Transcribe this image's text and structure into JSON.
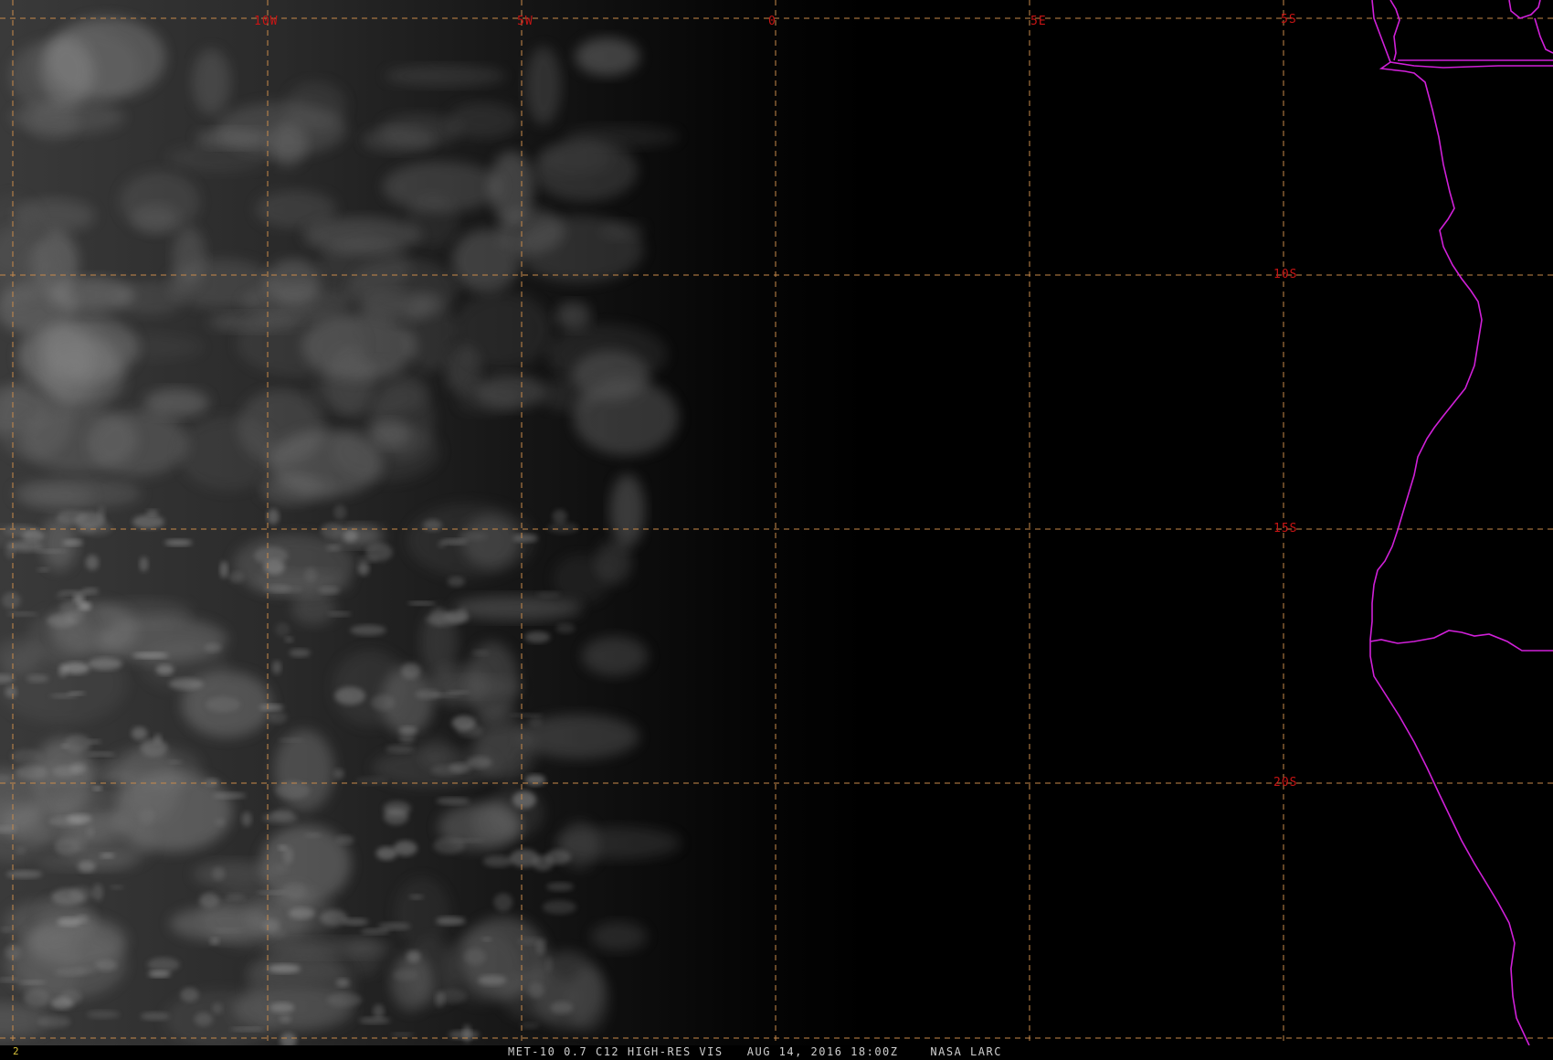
{
  "image": {
    "caption": "MET-10 0.7 C12 HIGH-RES VIS   AUG 14, 2016 18:00Z    NASA LARC",
    "frame_number": "2"
  },
  "grid": {
    "longitude_labels": [
      "10W",
      "5W",
      "0",
      "5E"
    ],
    "latitude_labels": [
      "5S",
      "10S",
      "15S",
      "20S"
    ]
  },
  "colors": {
    "background": "#000000",
    "grid_line": "#c88a4a",
    "grid_label": "#c81414",
    "coastline": "#d020d8",
    "caption_text": "#cfcfcf",
    "frame_number": "#d8c23a"
  }
}
